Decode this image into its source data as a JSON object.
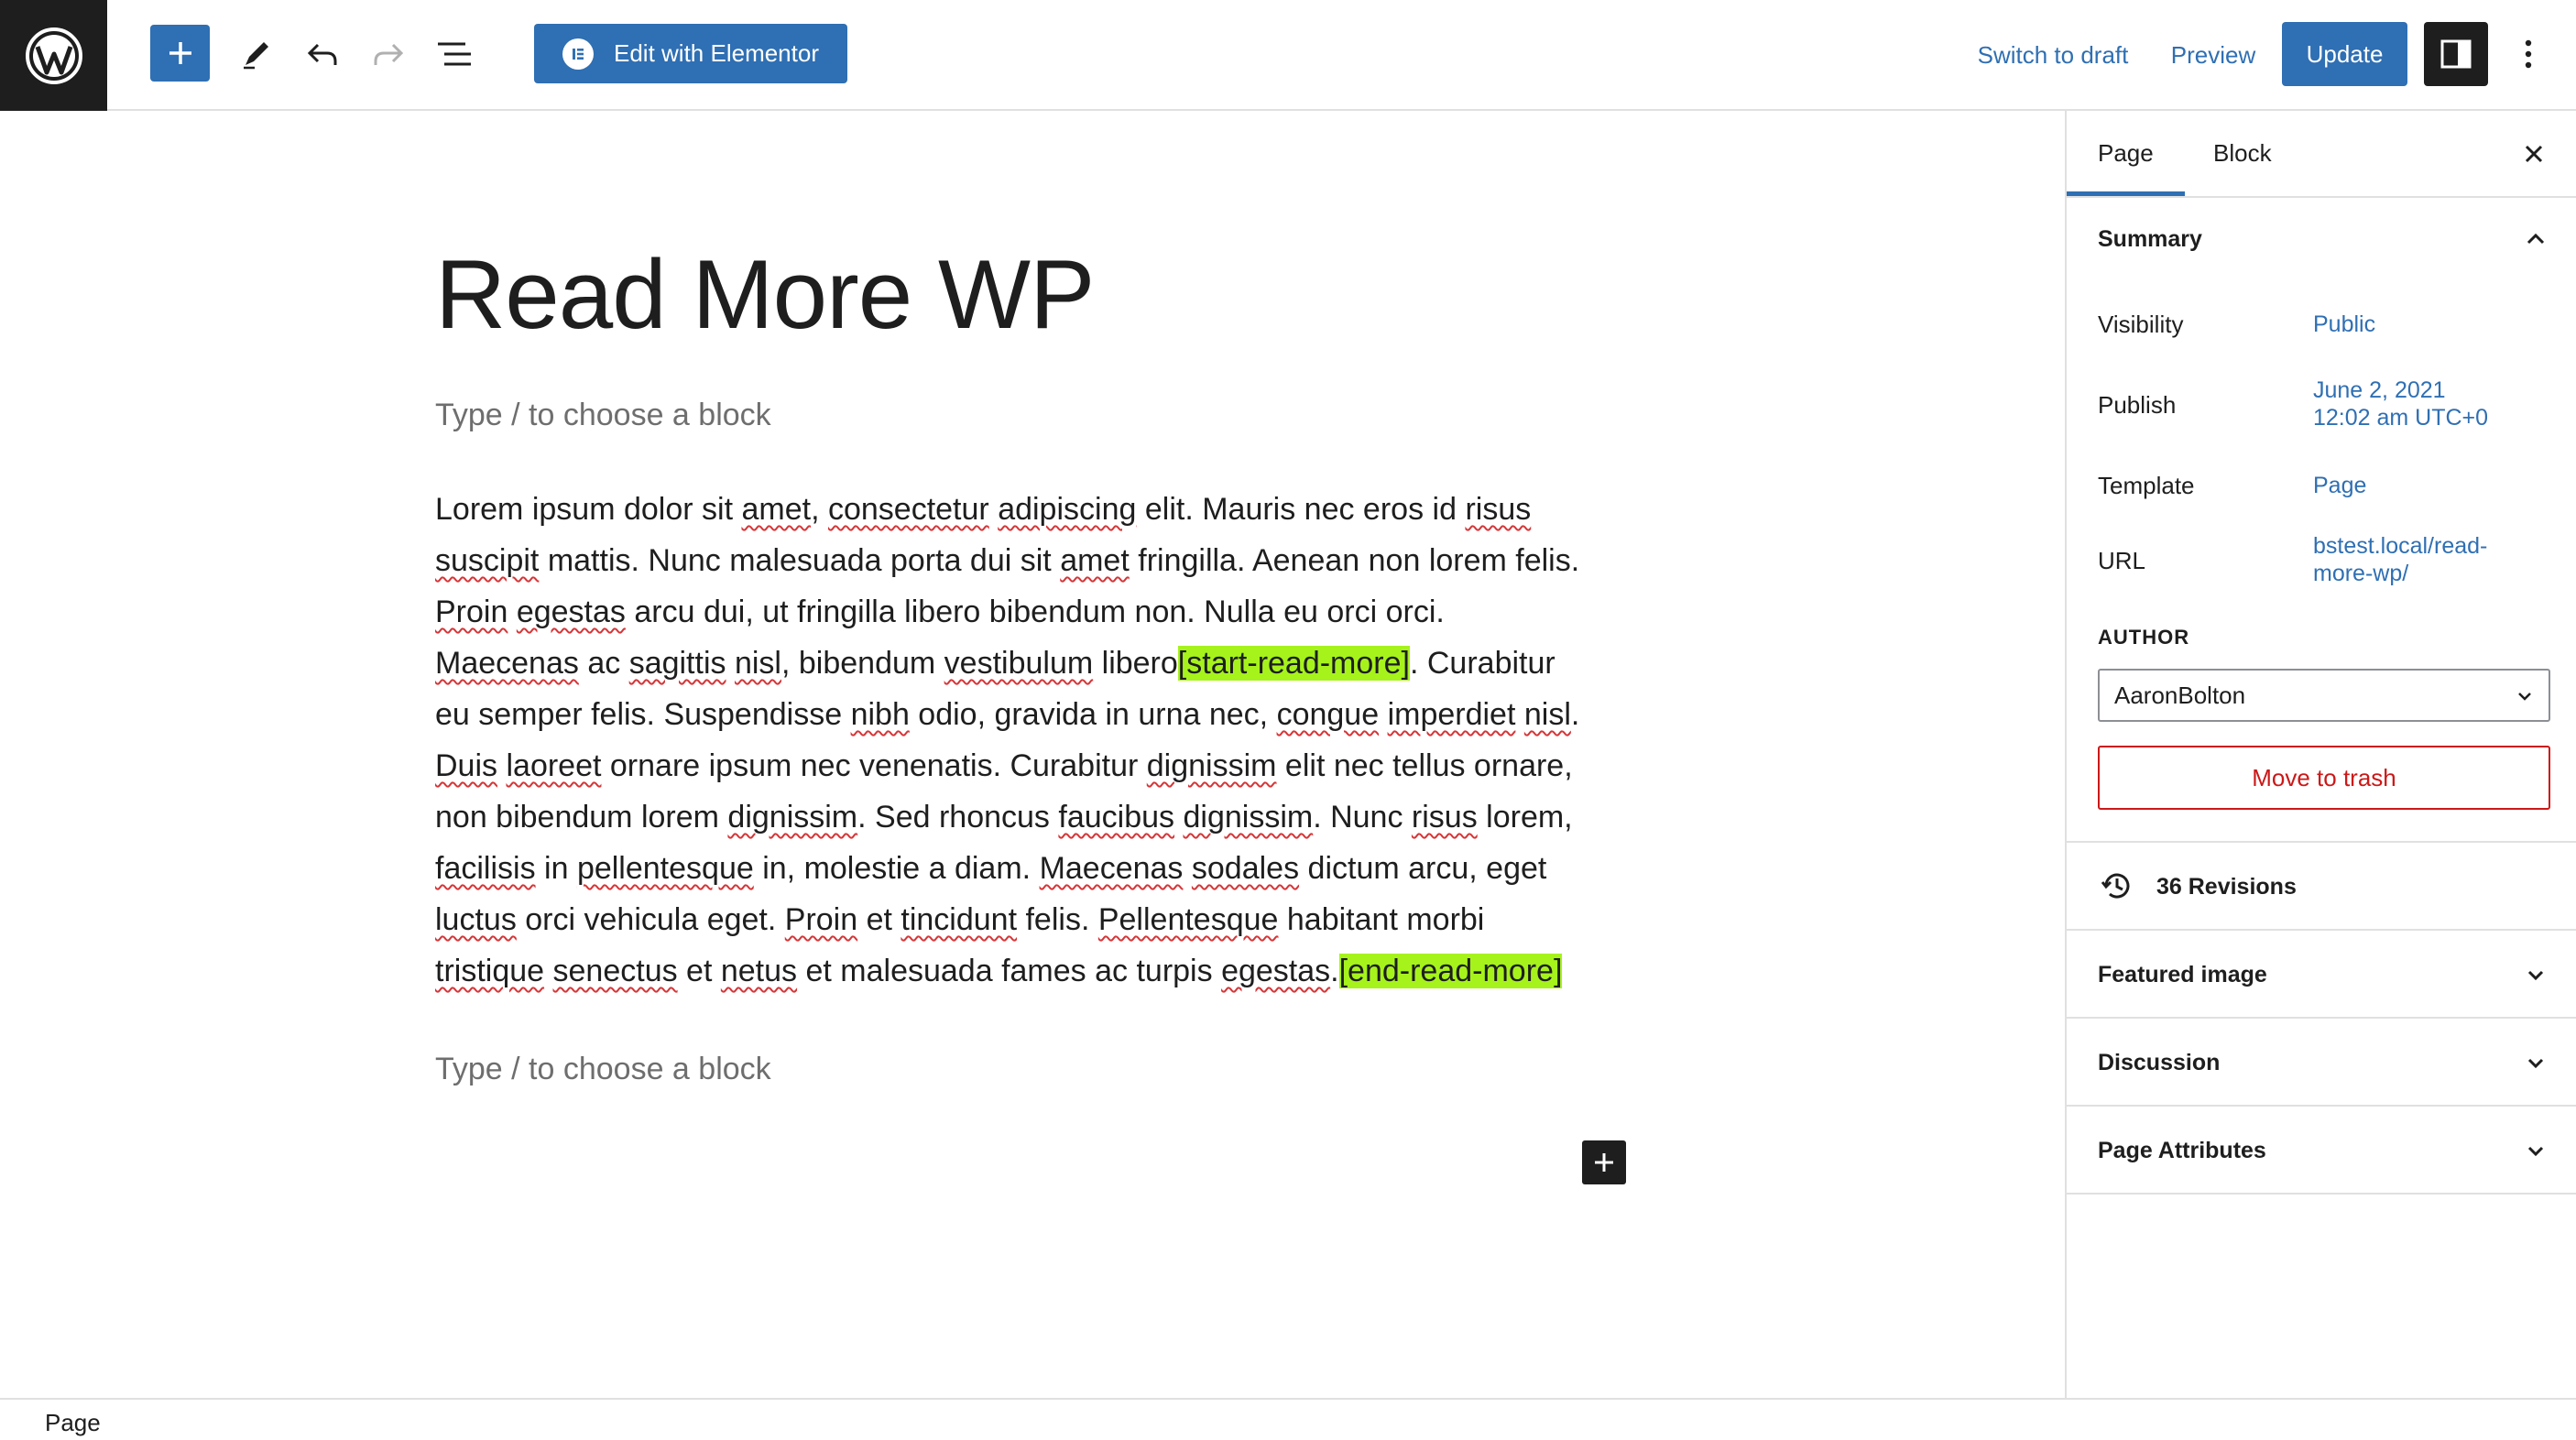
{
  "toolbar": {
    "elementor_label": "Edit with Elementor",
    "switch_to_draft": "Switch to draft",
    "preview": "Preview",
    "update": "Update",
    "icons": [
      "wordpress-logo-icon",
      "plus-icon",
      "pencil-icon",
      "undo-icon",
      "redo-icon",
      "list-view-icon",
      "elementor-icon",
      "settings-sidebar-icon",
      "more-vertical-icon"
    ]
  },
  "editor": {
    "title": "Read More WP",
    "placeholder_top": "Type / to choose a block",
    "placeholder_bottom": "Type / to choose a block",
    "paragraph_lines": [
      "Lorem ipsum dolor sit amet, consectetur adipiscing elit. Mauris nec eros id risus",
      "suscipit mattis. Nunc malesuada porta dui sit amet fringilla. Aenean non lorem felis.",
      "Proin egestas arcu dui, ut fringilla libero bibendum non. Nulla eu orci orci.",
      "Maecenas ac sagittis nisl, bibendum vestibulum libero[start-read-more]. Curabitur",
      "eu semper felis. Suspendisse nibh odio, gravida in urna nec, congue imperdiet nisl.",
      "Duis laoreet ornare ipsum nec venenatis. Curabitur dignissim elit nec tellus ornare,",
      "non bibendum lorem dignissim. Sed rhoncus faucibus dignissim. Nunc risus lorem,",
      "facilisis in pellentesque in, molestie a diam. Maecenas sodales dictum arcu, eget",
      "luctus orci vehicula eget. Proin et tincidunt felis. Pellentesque habitant morbi",
      "tristique senectus et netus et malesuada fames ac turpis egestas.[end-read-more]"
    ],
    "highlight_color": "#a6f31c",
    "spellcheck_color": "#d63638"
  },
  "sidebar": {
    "tabs": [
      "Page",
      "Block"
    ],
    "active_tab": "Page",
    "summary": {
      "title": "Summary",
      "visibility_label": "Visibility",
      "visibility_value": "Public",
      "publish_label": "Publish",
      "publish_date": "June 2, 2021",
      "publish_time": "12:02 am UTC+0",
      "template_label": "Template",
      "template_value": "Page",
      "url_label": "URL",
      "url_line1": "bstest.local/read-",
      "url_line2": "more-wp/",
      "author_label": "AUTHOR",
      "author_value": "AaronBolton",
      "trash_label": "Move to trash"
    },
    "revisions": "36 Revisions",
    "panels": [
      "Featured image",
      "Discussion",
      "Page Attributes"
    ]
  },
  "footer": {
    "breadcrumb": "Page"
  },
  "colors": {
    "accent": "#2f6fb3",
    "dark": "#1e1e1e",
    "danger": "#cc1818",
    "border": "#e0e0e0"
  }
}
